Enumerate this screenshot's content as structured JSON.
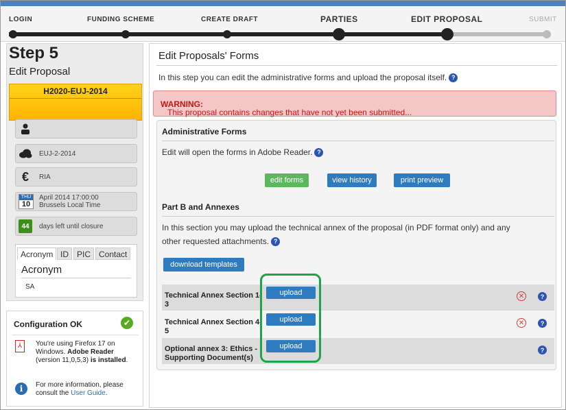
{
  "progress": {
    "steps": [
      {
        "label": "LOGIN",
        "state": "done"
      },
      {
        "label": "FUNDING SCHEME",
        "state": "done"
      },
      {
        "label": "CREATE DRAFT",
        "state": "done"
      },
      {
        "label": "PARTIES",
        "state": "done"
      },
      {
        "label": "EDIT PROPOSAL",
        "state": "current"
      },
      {
        "label": "SUBMIT",
        "state": "todo"
      }
    ]
  },
  "sidebar": {
    "step_title": "Step 5",
    "step_subtitle": "Edit Proposal",
    "call_id": "H2020-EUJ-2014",
    "topic": "EUJ-2-2014",
    "type_of_action": "RIA",
    "deadline_month": "THU",
    "deadline_day": "10",
    "deadline_line1": "April 2014  17:00:00",
    "deadline_line2": "Brussels Local Time",
    "days_left": "44",
    "days_left_label": "days left until closure",
    "tabs": [
      "Acronym",
      "ID",
      "PIC",
      "Contact"
    ],
    "acronym_title": "Acronym",
    "acronym_value": "SA"
  },
  "config": {
    "title": "Configuration OK",
    "line1": "You're using Firefox 17 on Windows.",
    "reader_bold": "Adobe Reader",
    "version": "(version 11,0,5,3)",
    "is_label": "is",
    "installed": "installed",
    "more_text": "For more information, please consult the",
    "guide_link": "User Guide",
    "more_end": "."
  },
  "main": {
    "title": "Edit Proposals' Forms",
    "intro": "In this step you can edit the administrative forms and upload the proposal itself.",
    "warning_label": "WARNING:",
    "warning_text": "This proposal contains changes that have not yet been submitted...",
    "admin_title": "Administrative Forms",
    "admin_text": "Edit will open the forms in Adobe Reader.",
    "btn_edit_forms": "edit forms",
    "btn_view_history": "view history",
    "btn_print_preview": "print preview",
    "partb_title": "Part B and Annexes",
    "partb_text_1": "In this section you may upload the technical annex of the proposal (in PDF format only) and any",
    "partb_text_2": "other requested attachments.",
    "btn_download_templates": "download templates",
    "annexes": [
      {
        "label": "Technical Annex Section 1-3",
        "upload": "upload"
      },
      {
        "label": "Technical Annex Section 4-5",
        "upload": "upload"
      },
      {
        "label": "Optional annex 3: Ethics - Supporting Document(s)",
        "upload": "upload"
      }
    ]
  },
  "colors": {
    "accent_blue": "#2f7bbf",
    "warning_bg": "#f5c6c6",
    "warning_text": "#c01818",
    "call_yellow": "#ffc20e",
    "highlight_green": "#1fa34a"
  }
}
